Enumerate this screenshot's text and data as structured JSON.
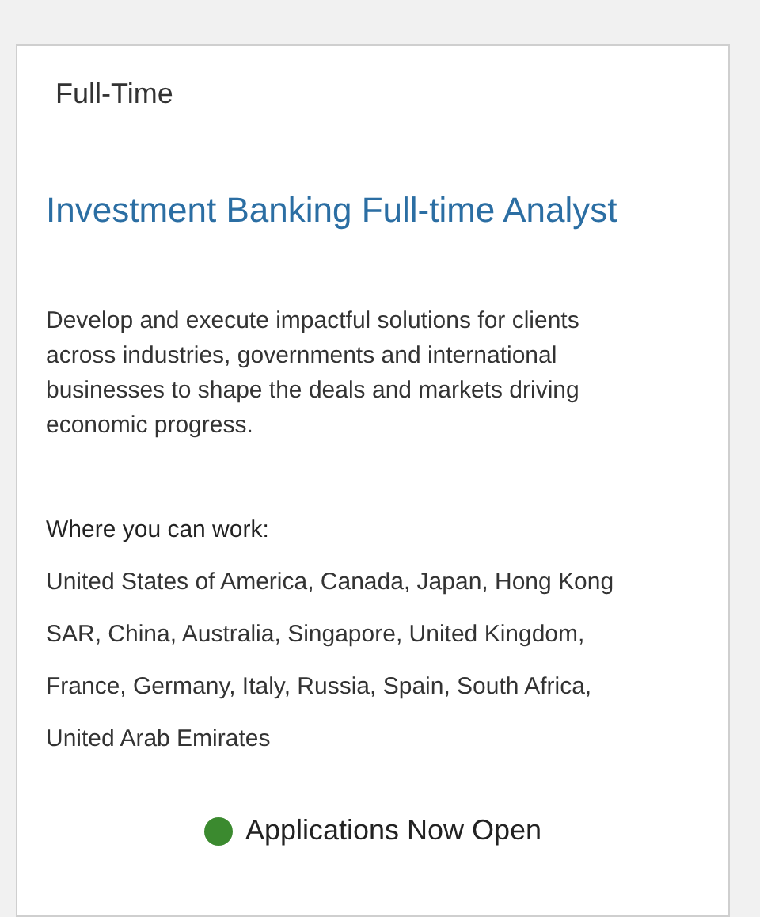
{
  "card": {
    "employment_type": "Full-Time",
    "title": "Investment Banking Full-time Analyst",
    "description": "Develop and execute impactful solutions for clients across industries, governments and international businesses to shape the deals and markets driving economic progress.",
    "locations_heading": "Where you can work:",
    "locations": "United States of America, Canada, Japan, Hong Kong SAR, China, Australia, Singapore, United Kingdom, France, Germany, Italy, Russia, Spain, South Africa, United Arab Emirates",
    "status": {
      "label": "Applications Now Open",
      "color": "#3b8a2f"
    }
  }
}
